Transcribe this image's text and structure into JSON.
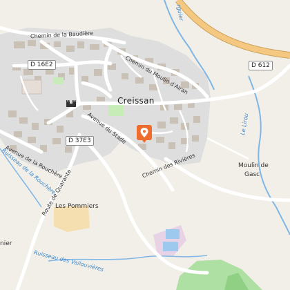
{
  "map": {
    "colors": {
      "background": "#f2efe9",
      "residential": "#dedede",
      "building": "#c9c0b6",
      "park": "#c7ecb8",
      "vineyard": "#aedfa3",
      "orchard": "#f5deb0",
      "highway": "#f5c882",
      "water": "#7fb6e6",
      "marker": "#ef6c2f"
    },
    "places": {
      "town": "Creissan",
      "les_pommiers": "Les Pommiers",
      "moulin_line1": "Moulin de",
      "moulin_line2": "Gasc",
      "partial_left": "nier"
    },
    "roads": {
      "d16e2": "D 16E2",
      "d37e3": "D 37E3",
      "d612": "D 612",
      "chemin_baudiere": "Chemin de la Baudière",
      "chemin_moulin": "Chemin du Moulin d'Alran",
      "avenue_stade": "Avenue du Stade",
      "chemin_rivieres": "Chemin des Rivières",
      "avenue_rouchere": "Avenue de la Rouchère",
      "route_quarante": "Route de Quarante"
    },
    "waterways": {
      "ruisseau_rouchere": "Ruisseau de la Rouchère",
      "ruisseau_vallouvieres": "Ruisseau des Vallouvières",
      "le_lirou": "Le Lirou",
      "top_stream": "rguier"
    },
    "icons": {
      "marker": "map-pin-icon",
      "castle": "castle-icon"
    }
  }
}
